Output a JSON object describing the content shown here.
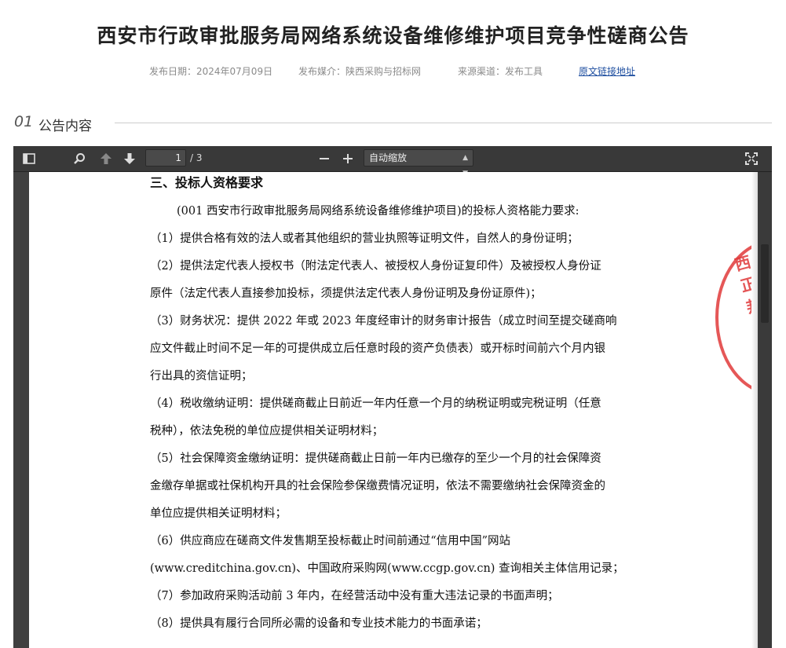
{
  "page": {
    "title": "西安市行政审批服务局网络系统设备维修维护项目竞争性磋商公告",
    "publish_date": "发布日期：2024年07月09日",
    "media": "发布媒介：陕西采购与招标网",
    "source": "来源渠道：发布工具",
    "original_link": "原文链接地址"
  },
  "section": {
    "number": "01",
    "label": "公告内容"
  },
  "viewer": {
    "current_page": "1",
    "page_count": "/ 3",
    "zoom_label": "自动缩放",
    "icons": [
      "sidebar-toggle-icon",
      "search-icon",
      "arrow-up-icon",
      "arrow-down-icon",
      "zoom-out-icon",
      "zoom-in-icon",
      "chevron-updown-icon",
      "fullscreen-icon"
    ]
  },
  "document": {
    "heading": "三、投标人资格要求",
    "lines": [
      "(001 西安市行政审批服务局网络系统设备维修维护项目)的投标人资格能力要求:",
      "（1）提供合格有效的法人或者其他组织的营业执照等证明文件，自然人的身份证明；",
      "（2）提供法定代表人授权书（附法定代表人、被授权人身份证复印件）及被授权人身份证",
      "原件（法定代表人直接参加投标，须提供法定代表人身份证明及身份证原件)；",
      "（3）财务状况：提供 2022 年或 2023 年度经审计的财务审计报告（成立时间至提交磋商响",
      "应文件截止时间不足一年的可提供成立后任意时段的资产负债表）或开标时间前六个月内银",
      "行出具的资信证明；",
      "（4）税收缴纳证明：提供磋商截止日前近一年内任意一个月的纳税证明或完税证明（任意",
      "税种），依法免税的单位应提供相关证明材料；",
      "（5）社会保障资金缴纳证明：提供磋商截止日前一年内已缴存的至少一个月的社会保障资",
      "金缴存单据或社保机构开具的社会保险参保缴费情况证明，依法不需要缴纳社会保障资金的",
      "单位应提供相关证明材料；",
      "（6）供应商应在磋商文件发售期至投标截止时间前通过“信用中国”网站",
      "(www.creditchina.gov.cn)、中国政府采购网(www.ccgp.gov.cn) 查询相关主体信用记录；",
      "（7）参加政府采购活动前 3 年内，在经营活动中没有重大违法记录的书面声明；",
      "（8）提供具有履行合同所必需的设备和专业技术能力的书面承诺；"
    ],
    "seal_text": "西正邦",
    "seal_color": "#e0393a"
  }
}
